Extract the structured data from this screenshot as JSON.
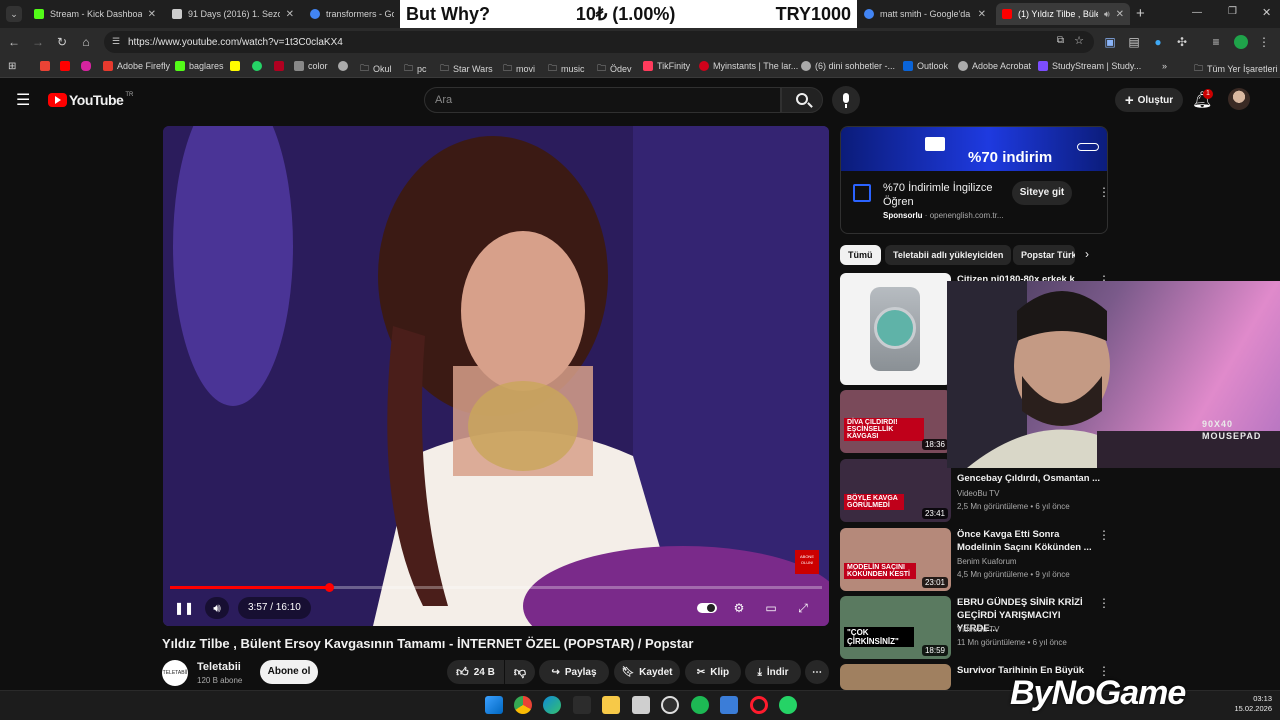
{
  "tabs": [
    {
      "title": "Stream - Kick Dashboard",
      "icon": "kick-icon",
      "color": "#53fc18"
    },
    {
      "title": "91 Days (2016) 1. Sezon",
      "icon": "anime-site-icon",
      "color": "#cccccc"
    },
    {
      "title": "transformers - Google",
      "icon": "google-icon",
      "color": "#4285f4"
    },
    {
      "title": "matt smith - Google'da A",
      "icon": "google-icon",
      "color": "#4285f4"
    },
    {
      "title": "(1) Yıldız Tilbe , Bülent",
      "icon": "youtube-icon",
      "color": "#ff0000",
      "active": true
    }
  ],
  "overlay": {
    "question": "But Why?",
    "donation": "10₺ (1.00%)",
    "goal": "TRY1000"
  },
  "address": {
    "url": "https://www.youtube.com/watch?v=1t3C0claKX4"
  },
  "bookmarks": [
    {
      "label": "",
      "icon": "gmail-icon",
      "color": "#ea4335"
    },
    {
      "label": "",
      "icon": "youtube-icon",
      "color": "#ff0000"
    },
    {
      "label": "",
      "icon": "instagram-icon",
      "color": "#d6249f"
    },
    {
      "label": "Adobe Firefly",
      "icon": "adobe-firefly-icon",
      "color": "#e63a2e"
    },
    {
      "label": "baglares",
      "icon": "kick-icon",
      "color": "#53fc18"
    },
    {
      "label": "",
      "icon": "snapchat-icon",
      "color": "#fffc00"
    },
    {
      "label": "",
      "icon": "whatsapp-icon",
      "color": "#25d366"
    },
    {
      "label": "",
      "icon": "app-icon",
      "color": "#b00020"
    },
    {
      "label": "color",
      "icon": "color-icon",
      "color": "#888888"
    },
    {
      "label": "",
      "icon": "globe-icon",
      "color": "#aaaaaa"
    },
    {
      "label": "Okul",
      "icon": "folder-icon",
      "color": "#cfcfcf"
    },
    {
      "label": "pc",
      "icon": "folder-icon",
      "color": "#cfcfcf"
    },
    {
      "label": "Star Wars",
      "icon": "folder-icon",
      "color": "#cfcfcf"
    },
    {
      "label": "movi",
      "icon": "folder-icon",
      "color": "#cfcfcf"
    },
    {
      "label": "music",
      "icon": "folder-icon",
      "color": "#cfcfcf"
    },
    {
      "label": "Ödev",
      "icon": "folder-icon",
      "color": "#cfcfcf"
    },
    {
      "label": "TikFinity",
      "icon": "tikfinity-icon",
      "color": "#ff3b5c"
    },
    {
      "label": "Myinstants | The lar...",
      "icon": "myinstants-icon",
      "color": "#d0021b"
    },
    {
      "label": "(6) dini sohbetler -...",
      "icon": "globe-icon",
      "color": "#aaaaaa"
    },
    {
      "label": "Outlook",
      "icon": "outlook-icon",
      "color": "#0a64d8"
    },
    {
      "label": "Adobe Acrobat",
      "icon": "globe-icon",
      "color": "#aaaaaa"
    },
    {
      "label": "StudyStream | Study...",
      "icon": "studystream-icon",
      "color": "#7c4dff"
    }
  ],
  "bookmarks_more": "»",
  "all_bookmarks": "Tüm Yer İşaretleri",
  "youtube": {
    "logo": "YouTube",
    "region": "TR",
    "search_placeholder": "Ara",
    "create_label": "Oluştur",
    "notification_count": "1"
  },
  "video": {
    "title": "Yıldız Tilbe , Bülent Ersoy Kavgasının Tamamı - İNTERNET ÖZEL (POPSTAR) / Popstar",
    "time": "3:57 / 16:10",
    "progress_percent": 24.4,
    "watermark": "ABONE OLUN!"
  },
  "channel": {
    "name": "Teletabii",
    "subs": "120 B abone",
    "avatar_text": "TELETABİİ",
    "subscribe_label": "Abone ol"
  },
  "actions": {
    "likes": "24 B",
    "share": "Paylaş",
    "save": "Kaydet",
    "clip": "Klip",
    "download": "İndir"
  },
  "ad": {
    "headline": "%70 indirim",
    "title": "%70 İndirimle İngilizce Öğren",
    "sponsor_label": "Sponsorlu",
    "sponsor_domain": "openenglish.com.tr...",
    "button": "Siteye git"
  },
  "chips": [
    "Tümü",
    "Teletabii adlı yükleyiciden",
    "Popstar Türk"
  ],
  "related": [
    {
      "title": "Citizen nj0180-80x erkek kol...",
      "channel": "",
      "meta": "",
      "duration": "",
      "thumb_text": "",
      "thumb_color": "#f3f3f3"
    },
    {
      "title": "",
      "channel": "",
      "meta": "",
      "duration": "18:36",
      "thumb_text": "DİVA ÇILDIRDI! EŞCİNSELLİK KAVGASI",
      "thumb_color": "#7a4a5a"
    },
    {
      "title": "Gencebay Çıldırdı, Osmantan ...",
      "channel": "VideoBu TV",
      "meta": "2,5 Mn görüntüleme • 6 yıl önce",
      "duration": "23:41",
      "thumb_text": "BÖYLE KAVGA GÖRÜLMEDİ",
      "thumb_color": "#3a2a40"
    },
    {
      "title": "Önce Kavga Etti Sonra Modelinin Saçını Kökünden ...",
      "channel": "Benim Kuaforum",
      "meta": "4,5 Mn görüntüleme • 9 yıl önce",
      "duration": "23:01",
      "thumb_text": "MODELİN SAÇINI KÖKÜNDEN KESTİ",
      "thumb_color": "#b5897a"
    },
    {
      "title": "EBRU GÜNDEŞ SİNİR KRİZİ GEÇİRDİ YARIŞMACIYI YERDE...",
      "channel": "VideoBu TV",
      "meta": "11 Mn görüntüleme • 6 yıl önce",
      "duration": "18:59",
      "thumb_text": "\"ÇOK ÇİRKİNSİNİZ\"",
      "thumb_color": "#5a7a60"
    },
    {
      "title": "Survivor Tarihinin En Büyük Kapışmaları...",
      "channel": "",
      "meta": "",
      "duration": "",
      "thumb_text": "",
      "thumb_color": "#a08060"
    }
  ],
  "webcam": {
    "mousepad_text": "90X40 MOUSEPAD"
  },
  "brand_watermark": "ByNoGame",
  "clock": {
    "time": "03:13",
    "date": "15.02.2026"
  }
}
